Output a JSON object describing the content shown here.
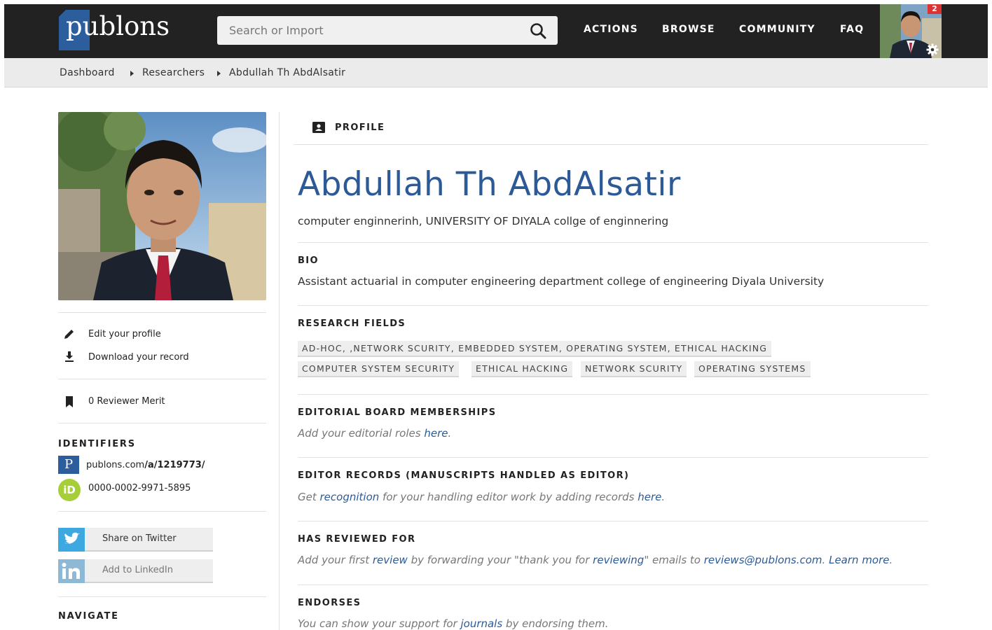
{
  "header": {
    "logo": "publons",
    "search_placeholder": "Search or Import",
    "nav": [
      "ACTIONS",
      "BROWSE",
      "COMMUNITY",
      "FAQ"
    ],
    "notification_count": "2"
  },
  "breadcrumb": [
    "Dashboard",
    "Researchers",
    "Abdullah Th AbdAlsatir"
  ],
  "sidebar": {
    "edit_profile": "Edit your profile",
    "download_record": "Download your record",
    "reviewer_merit": "0 Reviewer Merit",
    "identifiers_heading": "IDENTIFIERS",
    "publons_url_prefix": "publons.com",
    "publons_url_path": "/a/1219773/",
    "orcid": "0000-0002-9971-5895",
    "orcid_logo": "iD",
    "share_twitter": "Share on Twitter",
    "add_linkedin": "Add to LinkedIn",
    "navigate_heading": "NAVIGATE"
  },
  "profile": {
    "tab": "PROFILE",
    "name": "Abdullah Th AbdAlsatir",
    "affiliation": "computer enginnerinh, UNIVERSITY OF DIYALA collge of enginnering",
    "bio_title": "BIO",
    "bio": "Assistant actuarial in computer engineering department college of engineering Diyala University",
    "research_fields_title": "RESEARCH FIELDS",
    "research_fields": [
      "AD-HOC, ,NETWORK SCURITY, EMBEDDED SYSTEM, OPERATING SYSTEM, ETHICAL HACKING",
      "COMPUTER SYSTEM SECURITY",
      "ETHICAL HACKING",
      "NETWORK SCURITY",
      "OPERATING SYSTEMS"
    ],
    "editorial_title": "EDITORIAL BOARD MEMBERSHIPS",
    "editorial_text": "Add your editorial roles ",
    "editorial_link": "here",
    "editor_records_title": "EDITOR RECORDS (MANUSCRIPTS HANDLED AS EDITOR)",
    "editor_records_pre": "Get ",
    "editor_records_link1": "recognition",
    "editor_records_mid": " for your handling editor work by adding records ",
    "editor_records_link2": "here",
    "reviewed_title": "HAS REVIEWED FOR",
    "reviewed_pre": "Add your first ",
    "reviewed_link1": "review",
    "reviewed_mid1": " by forwarding your \"thank you for ",
    "reviewed_link2": "reviewing",
    "reviewed_mid2": "\" emails to ",
    "reviewed_link3": "reviews@publons.com",
    "reviewed_link4": "Learn more",
    "endorses_title": "ENDORSES",
    "endorses_pre": "You can show your support for ",
    "endorses_link": "journals",
    "endorses_post": " by endorsing them."
  }
}
